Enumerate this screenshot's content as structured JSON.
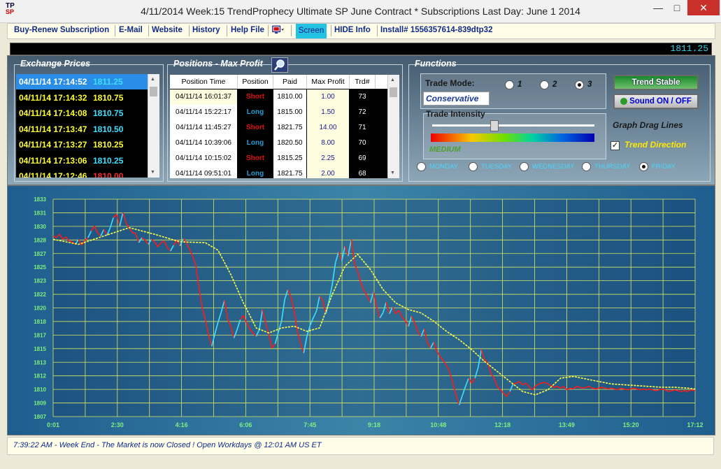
{
  "window": {
    "title": "4/11/2014 Week:15 TrendProphecy Ultimate SP June Contract * Subscriptions Last Day: June 1 2014",
    "logo_text": "TP",
    "logo_sub": "SP"
  },
  "menu": {
    "items": [
      "Buy-Renew Subscription",
      "E-Mail",
      "Website",
      "History",
      "Help File"
    ],
    "screen_label": "Screen",
    "hide_info": "HIDE Info",
    "install": "Install# 1556357614-839dtp32"
  },
  "price_display": "1811.25",
  "exchange": {
    "title": "Exchange Prices",
    "rows": [
      {
        "time": "04/11/14 17:14:52",
        "price": "1811.25",
        "dir": "up",
        "selected": true
      },
      {
        "time": "04/11/14 17:14:32",
        "price": "1810.75",
        "dir": "flat"
      },
      {
        "time": "04/11/14 17:14:08",
        "price": "1810.75",
        "dir": "up"
      },
      {
        "time": "04/11/14 17:13:47",
        "price": "1810.50",
        "dir": "up"
      },
      {
        "time": "04/11/14 17:13:27",
        "price": "1810.25",
        "dir": "flat"
      },
      {
        "time": "04/11/14 17:13:06",
        "price": "1810.25",
        "dir": "up"
      },
      {
        "time": "04/11/14 17:12:46",
        "price": "1810.00",
        "dir": "down"
      }
    ]
  },
  "positions": {
    "title": "Positions - Max Profit",
    "headers": [
      "Position Time",
      "Position",
      "Paid",
      "Max Profit",
      "Trd#"
    ],
    "rows": [
      {
        "time": "04/11/14 16:01:37",
        "position": "Short",
        "paid": "1810.00",
        "max_profit": "1.00",
        "trd": "73"
      },
      {
        "time": "04/11/14 15:22:17",
        "position": "Long",
        "paid": "1815.00",
        "max_profit": "1.50",
        "trd": "72"
      },
      {
        "time": "04/11/14 11:45:27",
        "position": "Short",
        "paid": "1821.75",
        "max_profit": "14.00",
        "trd": "71"
      },
      {
        "time": "04/11/14 10:39:06",
        "position": "Long",
        "paid": "1820.50",
        "max_profit": "8.00",
        "trd": "70"
      },
      {
        "time": "04/11/14 10:15:02",
        "position": "Short",
        "paid": "1815.25",
        "max_profit": "2.25",
        "trd": "69"
      },
      {
        "time": "04/11/14 09:51:01",
        "position": "Long",
        "paid": "1821.75",
        "max_profit": "2.00",
        "trd": "68"
      }
    ],
    "colors": {
      "Short": "#e01010",
      "Long": "#1e9ed8"
    }
  },
  "functions": {
    "title": "Functions",
    "trade_mode_label": "Trade Mode:",
    "trade_mode_value": "Conservative",
    "modes": [
      "1",
      "2",
      "3"
    ],
    "selected_mode": "3",
    "intensity_label": "Trade Intensity",
    "intensity_value": "MEDIUM",
    "intensity_level": 0.38,
    "trend_button": "Trend Stable",
    "sound_button": "Sound ON / OFF",
    "graph_drag_label": "Graph Drag Lines",
    "trend_direction_label": "Trend Direction",
    "trend_direction_checked": true,
    "days": [
      "MONDAY",
      "TUESDAY",
      "WEDNESDAY",
      "THURSDAY",
      "FRIDAY"
    ],
    "selected_day": "FRIDAY"
  },
  "chart_data": {
    "type": "line",
    "y_ticks": [
      "1833",
      "1831",
      "1830",
      "1828",
      "1827",
      "1825",
      "1823",
      "1822",
      "1820",
      "1818",
      "1817",
      "1815",
      "1813",
      "1812",
      "1810",
      "1809",
      "1807"
    ],
    "ylim": [
      1807,
      1833
    ],
    "x_ticks": [
      "0:01",
      "2:30",
      "4:16",
      "6:06",
      "7:45",
      "9:18",
      "10:48",
      "12:18",
      "13:49",
      "15:20",
      "17:12"
    ],
    "grid": true,
    "series": [
      {
        "color": "#ff1a1a",
        "highlight_color": "#3de0ff",
        "x": [
          0,
          5,
          10,
          15,
          20,
          25,
          30,
          35,
          40,
          45,
          50,
          55,
          60,
          65,
          70,
          75,
          80,
          85,
          90,
          95,
          100,
          105,
          110,
          115,
          120,
          125,
          130,
          135,
          140,
          145,
          150,
          155,
          160,
          165,
          170,
          175,
          180,
          185,
          190,
          195,
          200,
          205,
          210,
          215,
          220,
          225,
          230,
          235,
          240,
          245,
          250,
          255,
          260,
          265,
          270,
          275,
          280,
          285,
          290,
          295,
          300,
          305,
          310,
          315,
          320,
          325,
          330,
          335,
          340,
          345,
          350,
          355,
          360,
          365,
          370,
          375,
          380,
          385,
          390,
          395,
          400,
          405,
          410,
          415,
          420,
          425,
          430,
          435,
          440,
          445,
          450,
          455,
          460,
          465,
          470,
          475,
          480,
          485,
          490,
          495,
          500,
          505,
          510,
          515,
          520,
          525,
          530,
          535,
          540,
          545,
          550,
          555,
          560,
          565,
          570,
          575,
          580,
          585,
          590,
          595,
          600,
          605,
          610,
          615,
          620,
          625,
          630,
          635,
          640,
          645,
          650,
          655,
          660,
          665,
          670,
          675,
          680,
          685,
          690,
          695,
          700,
          705,
          710,
          715,
          720,
          725,
          730,
          735,
          740,
          745,
          750,
          755,
          760,
          765,
          770,
          775,
          780,
          785,
          790,
          795,
          800,
          805,
          810,
          815,
          820,
          825,
          830,
          835,
          840,
          845,
          850,
          855,
          860,
          865,
          870,
          875,
          880,
          885,
          890,
          895,
          900,
          905,
          910,
          915,
          920,
          925,
          930,
          935,
          940,
          945,
          950,
          955,
          960,
          965,
          970,
          975,
          980,
          985,
          990,
          995,
          1000,
          1005,
          1012
        ],
        "y": [
          1828.6,
          1828.4,
          1828.8,
          1828.2,
          1828.5,
          1828.0,
          1827.9,
          1827.6,
          1828.2,
          1827.5,
          1828.1,
          1828.4,
          1829.2,
          1829.8,
          1829.0,
          1828.6,
          1829.4,
          1828.7,
          1829.6,
          1830.8,
          1831.2,
          1829.8,
          1831.4,
          1830.2,
          1829.5,
          1829.0,
          1828.9,
          1827.8,
          1828.4,
          1828.1,
          1827.6,
          1828.2,
          1827.9,
          1827.3,
          1827.8,
          1828.0,
          1827.2,
          1826.8,
          1827.5,
          1828.1,
          1827.4,
          1828.3,
          1827.8,
          1827.0,
          1826.2,
          1825.0,
          1822.4,
          1820.0,
          1818.6,
          1816.8,
          1815.4,
          1816.9,
          1818.3,
          1819.5,
          1820.9,
          1818.7,
          1817.8,
          1816.4,
          1817.4,
          1818.6,
          1819.1,
          1818.2,
          1817.5,
          1817.0,
          1816.6,
          1817.4,
          1819.8,
          1818.2,
          1816.8,
          1815.2,
          1815.7,
          1817.1,
          1818.4,
          1821.0,
          1822.2,
          1821.3,
          1819.6,
          1817.2,
          1815.8,
          1814.6,
          1816.6,
          1817.9,
          1818.8,
          1819.6,
          1821.4,
          1820.9,
          1819.3,
          1820.9,
          1822.8,
          1825.4,
          1826.7,
          1825.6,
          1827.4,
          1826.2,
          1828.2,
          1825.3,
          1824.4,
          1823.0,
          1822.1,
          1821.4,
          1820.6,
          1821.9,
          1820.1,
          1818.8,
          1819.4,
          1820.7,
          1819.3,
          1820.1,
          1819.3,
          1819.7,
          1818.9,
          1818.5,
          1817.8,
          1819.0,
          1818.2,
          1817.1,
          1816.6,
          1817.5,
          1815.8,
          1815.2,
          1815.9,
          1814.8,
          1814.2,
          1813.7,
          1813.1,
          1812.4,
          1811.0,
          1809.6,
          1808.4,
          1809.5,
          1810.6,
          1811.6,
          1811.0,
          1811.6,
          1812.9,
          1815.0,
          1813.8,
          1813.4,
          1812.2,
          1811.6,
          1810.6,
          1810.2,
          1809.8,
          1809.4,
          1810.0,
          1810.9,
          1811.0,
          1811.2,
          1810.8,
          1811.0,
          1810.6,
          1810.2,
          1810.6,
          1810.9,
          1811.0,
          1811.1,
          1810.9,
          1810.7,
          1810.5,
          1810.6,
          1810.4,
          1810.6,
          1810.2,
          1810.4,
          1810.3,
          1810.6,
          1810.5,
          1810.4,
          1810.5,
          1810.6,
          1810.4,
          1810.3,
          1810.4,
          1810.5,
          1810.4,
          1810.3,
          1810.4,
          1810.3,
          1810.2,
          1810.4,
          1810.3,
          1810.2,
          1810.3,
          1810.4,
          1810.3,
          1810.2,
          1810.3,
          1810.2,
          1810.3,
          1810.2,
          1810.1,
          1810.2,
          1810.3,
          1810.2,
          1810.0,
          1810.1,
          1810.2,
          1810.1,
          1810.0,
          1810.1,
          1810.0,
          1810.2,
          1810.1
        ]
      },
      {
        "color": "#ffff44",
        "name": "",
        "x": [
          0,
          40,
          80,
          120,
          160,
          200,
          240,
          260,
          280,
          300,
          320,
          340,
          360,
          380,
          400,
          420,
          440,
          460,
          480,
          500,
          520,
          540,
          560,
          580,
          600,
          620,
          640,
          660,
          680,
          700,
          720,
          740,
          760,
          780,
          800,
          820,
          840,
          860,
          880,
          900,
          920,
          940,
          960,
          980,
          1000,
          1012
        ],
        "y": [
          1828.2,
          1827.6,
          1828.6,
          1829.6,
          1828.8,
          1827.9,
          1827.8,
          1826.9,
          1824.0,
          1820.6,
          1817.6,
          1817.0,
          1817.6,
          1817.8,
          1817.2,
          1817.6,
          1821.6,
          1825.0,
          1826.4,
          1824.6,
          1822.2,
          1820.6,
          1819.8,
          1819.4,
          1818.4,
          1817.2,
          1816.2,
          1815.0,
          1813.6,
          1812.4,
          1811.2,
          1810.0,
          1809.6,
          1810.2,
          1811.6,
          1811.8,
          1811.5,
          1811.2,
          1810.9,
          1810.8,
          1810.7,
          1810.6,
          1810.5,
          1810.5,
          1810.4,
          1810.3
        ]
      }
    ]
  },
  "status": "7:39:22 AM - Week End - The Market is now Closed !  Open Workdays @ 12:01 AM US ET"
}
